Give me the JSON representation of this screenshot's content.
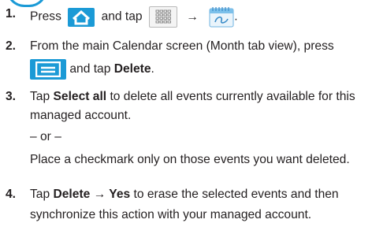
{
  "steps": [
    {
      "number": "1.",
      "press": "Press",
      "and_tap": "and tap",
      "arrow": "→",
      "end": "."
    },
    {
      "number": "2.",
      "line1": "From the main Calendar screen (Month tab view), press",
      "and_tap": "and tap",
      "target": "Delete",
      "end": "."
    },
    {
      "number": "3.",
      "tap": "Tap",
      "target": "Select all",
      "line1_rest": "to delete all events currently available for this",
      "line2": "managed account.",
      "or": "– or –",
      "line4": "Place a checkmark only on those events you want deleted."
    },
    {
      "number": "4.",
      "tap": "Tap",
      "target": "Delete → Yes",
      "line1_rest": "to erase the selected events and then",
      "line2": "synchronize this action with your managed account."
    }
  ],
  "icons": {
    "home": "home-icon",
    "apps": "apps-icon",
    "calendar": "calendar-icon",
    "menu": "menu-icon"
  },
  "colors": {
    "accent": "#1b9ad6",
    "text": "#231f20"
  }
}
